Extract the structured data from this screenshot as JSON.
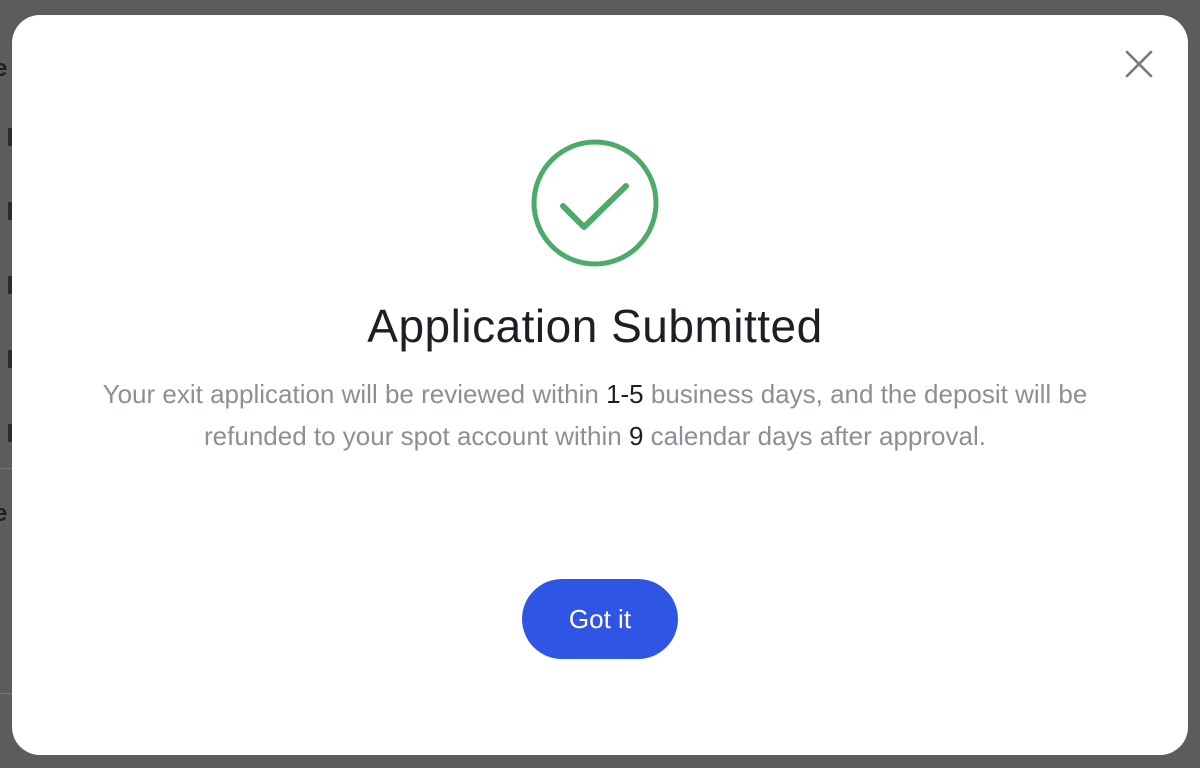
{
  "dialog": {
    "title": "Application Submitted",
    "message": {
      "part1": "Your exit application will be reviewed within ",
      "review_days": "1-5",
      "part2": " business days, and the deposit will be refunded to your spot account within ",
      "refund_days": "9",
      "part3": " calendar days after approval."
    },
    "confirm_label": "Got it"
  },
  "colors": {
    "success": "#4caa6b",
    "button": "#2f55e4",
    "overlay": "#5c5c5c"
  },
  "icons": {
    "close": "close-icon",
    "success": "check-circle-icon"
  }
}
